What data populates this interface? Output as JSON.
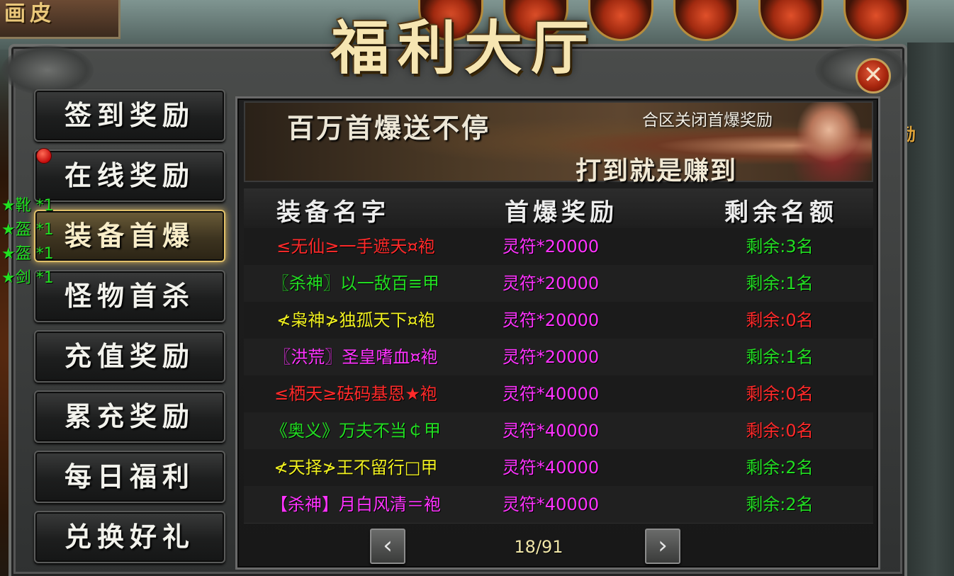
{
  "hud": {
    "top_left_label": "画皮",
    "right_edge_label": "励"
  },
  "window": {
    "title": "福利大厅",
    "close_label": "✕"
  },
  "menu": {
    "items": [
      {
        "label": "签到奖励",
        "active": false
      },
      {
        "label": "在线奖励",
        "active": false,
        "notify": true
      },
      {
        "label": "装备首爆",
        "active": true
      },
      {
        "label": "怪物首杀",
        "active": false
      },
      {
        "label": "充值奖励",
        "active": false
      },
      {
        "label": "累充奖励",
        "active": false
      },
      {
        "label": "每日福利",
        "active": false
      },
      {
        "label": "兑换好礼",
        "active": false
      }
    ]
  },
  "drops": [
    "★靴 *1",
    "★盔 *1",
    "★盔 *1",
    "★剑 *1"
  ],
  "banner": {
    "headline": "百万首爆送不停",
    "note": "合区关闭首爆奖励",
    "tagline": "打到就是赚到"
  },
  "table": {
    "headers": [
      "装备名字",
      "首爆奖励",
      "剩余名额"
    ],
    "rows": [
      {
        "name": "≤无仙≥一手遮天¤袍",
        "name_color": "#ff2a2a",
        "reward": "灵符*20000",
        "remain": "剩余:3名",
        "remain_color": "#22dd22"
      },
      {
        "name": "〖杀神〗以一敌百≡甲",
        "name_color": "#22dd22",
        "reward": "灵符*20000",
        "remain": "剩余:1名",
        "remain_color": "#22dd22"
      },
      {
        "name": "≮枭神≯独孤天下¤袍",
        "name_color": "#f0f020",
        "reward": "灵符*20000",
        "remain": "剩余:0名",
        "remain_color": "#ff2a2a"
      },
      {
        "name": "〖洪荒〗圣皇嗜血¤袍",
        "name_color": "#ff33ff",
        "reward": "灵符*20000",
        "remain": "剩余:1名",
        "remain_color": "#22dd22"
      },
      {
        "name": "≤栖天≥砝码基恩★袍",
        "name_color": "#ff2a2a",
        "reward": "灵符*40000",
        "remain": "剩余:0名",
        "remain_color": "#ff2a2a"
      },
      {
        "name": "《奥义》万夫不当￠甲",
        "name_color": "#22dd22",
        "reward": "灵符*40000",
        "remain": "剩余:0名",
        "remain_color": "#ff2a2a"
      },
      {
        "name": "≮天择≯王不留行□甲",
        "name_color": "#f0f020",
        "reward": "灵符*40000",
        "remain": "剩余:2名",
        "remain_color": "#22dd22"
      },
      {
        "name": "【杀神】月白风清＝袍",
        "name_color": "#ff33ff",
        "reward": "灵符*40000",
        "remain": "剩余:2名",
        "remain_color": "#22dd22"
      }
    ],
    "reward_color": "#ff33ff"
  },
  "pager": {
    "prev_label": "‹",
    "next_label": "›",
    "page_text": "18/91"
  }
}
